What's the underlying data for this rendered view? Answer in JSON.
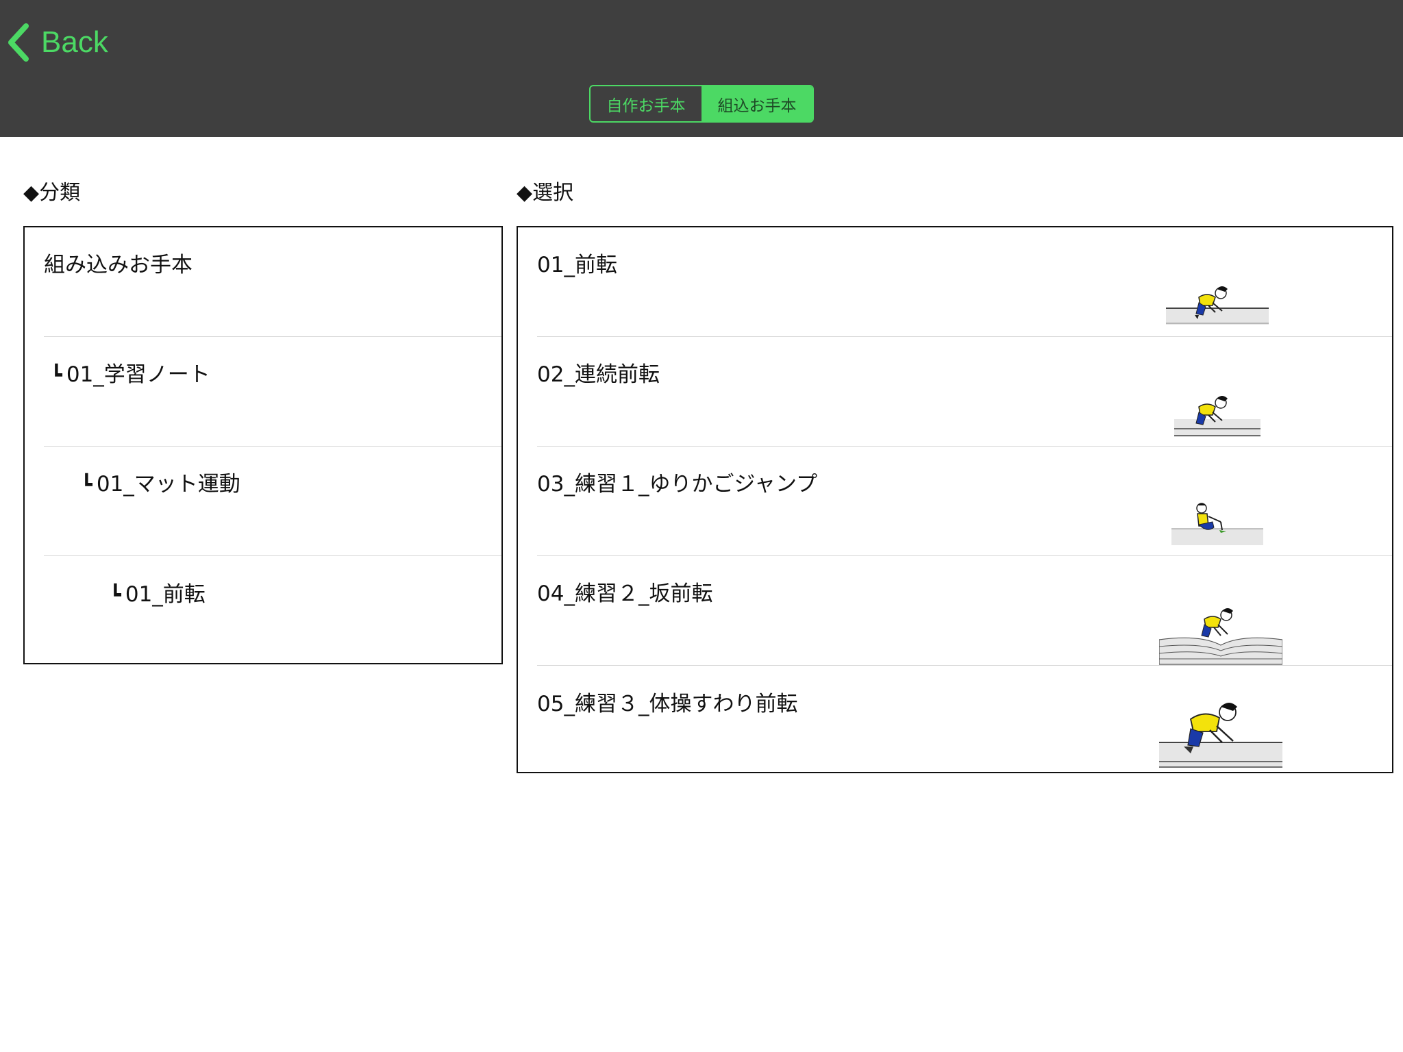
{
  "navbar": {
    "back_label": "Back",
    "accent_color": "#4cd964",
    "background_color": "#3f3f3f",
    "segments": [
      {
        "label": "自作お手本",
        "selected": false
      },
      {
        "label": "組込お手本",
        "selected": true
      }
    ]
  },
  "category": {
    "title": "◆分類",
    "items": [
      {
        "mark": "",
        "label": "組み込みお手本"
      },
      {
        "mark": "┗",
        "label": "01_学習ノート"
      },
      {
        "mark": "┗",
        "label": "01_マット運動"
      },
      {
        "mark": "┗",
        "label": "01_前転"
      }
    ]
  },
  "selection": {
    "title": "◆選択",
    "items": [
      {
        "label": "01_前転",
        "thumbnail": "crouching-figure-thumbnail"
      },
      {
        "label": "02_連続前転",
        "thumbnail": "crouching-figure-thumbnail"
      },
      {
        "label": "03_練習１_ゆりかごジャンプ",
        "thumbnail": "sitting-figure-thumbnail"
      },
      {
        "label": "04_練習２_坂前転",
        "thumbnail": "crouching-figure-on-slope-thumbnail"
      },
      {
        "label": "05_練習３_体操すわり前転",
        "thumbnail": "crouching-figure-thumbnail"
      }
    ]
  }
}
